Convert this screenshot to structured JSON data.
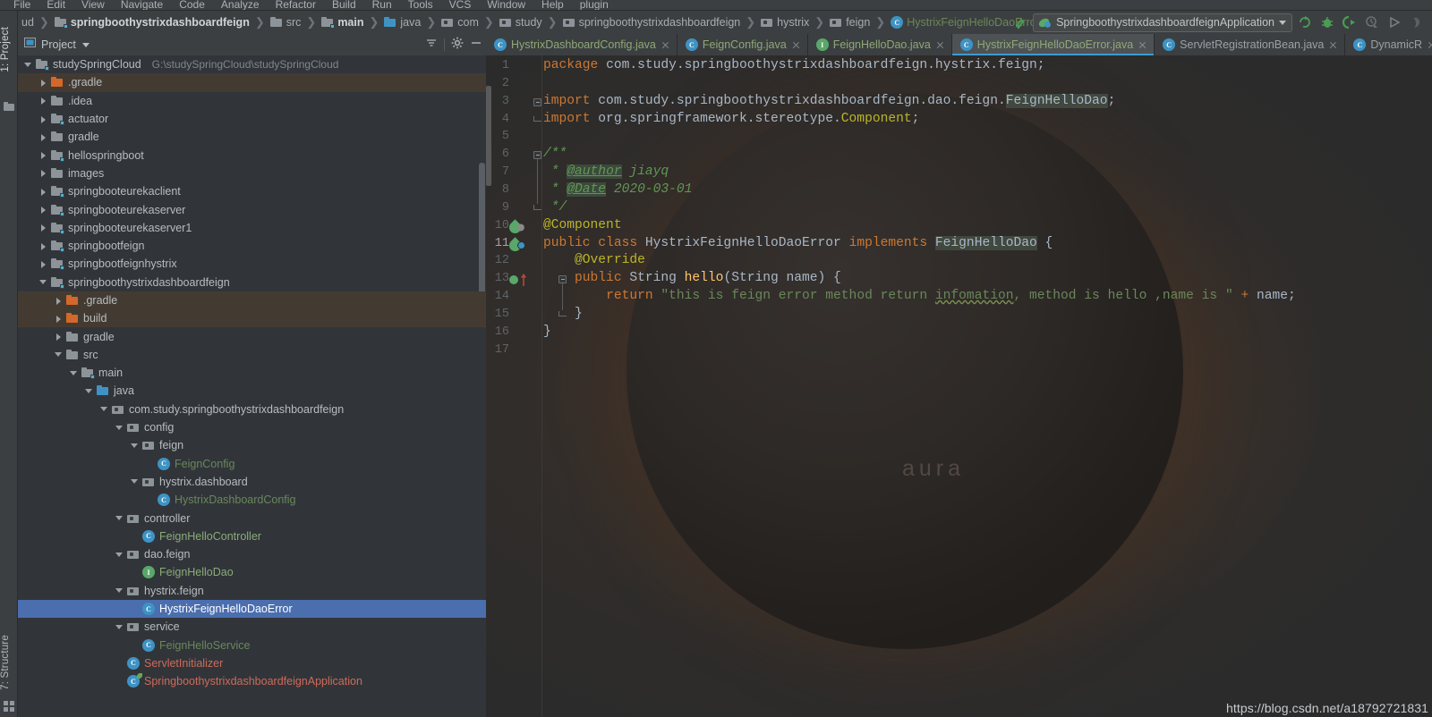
{
  "menu": {
    "items": [
      "File",
      "Edit",
      "View",
      "Navigate",
      "Code",
      "Analyze",
      "Refactor",
      "Build",
      "Run",
      "Tools",
      "VCS",
      "Window",
      "Help",
      "plugin"
    ]
  },
  "breadcrumb": {
    "items": [
      {
        "label": "ud",
        "icon": "folder-icon",
        "bold": false,
        "kind": "plain"
      },
      {
        "label": "springboothystrixdashboardfeign",
        "icon": "module-folder-icon",
        "bold": true,
        "kind": "module"
      },
      {
        "label": "src",
        "icon": "folder-icon",
        "bold": false,
        "kind": "plain"
      },
      {
        "label": "main",
        "icon": "module-folder-icon",
        "bold": true,
        "kind": "module"
      },
      {
        "label": "java",
        "icon": "source-folder-icon",
        "bold": false,
        "kind": "source"
      },
      {
        "label": "com",
        "icon": "package-icon",
        "bold": false,
        "kind": "package"
      },
      {
        "label": "study",
        "icon": "package-icon",
        "bold": false,
        "kind": "package"
      },
      {
        "label": "springboothystrixdashboardfeign",
        "icon": "package-icon",
        "bold": false,
        "kind": "package"
      },
      {
        "label": "hystrix",
        "icon": "package-icon",
        "bold": false,
        "kind": "package"
      },
      {
        "label": "feign",
        "icon": "package-icon",
        "bold": false,
        "kind": "package"
      },
      {
        "label": "HystrixFeignHelloDaoError",
        "icon": "class-icon",
        "bold": false,
        "kind": "class"
      }
    ]
  },
  "toolbar": {
    "run_configuration": "SpringboothystrixdashboardfeignApplication",
    "buttons": [
      {
        "name": "rerun-button",
        "title": "Rerun"
      },
      {
        "name": "debug-button",
        "title": "Debug"
      },
      {
        "name": "run-with-coverage-button",
        "title": "Run with Coverage"
      },
      {
        "name": "profile-button",
        "title": "Profile"
      },
      {
        "name": "run-button",
        "title": "Run"
      },
      {
        "name": "stop-button",
        "title": "Stop"
      }
    ]
  },
  "left_strips": {
    "project_tab": "1: Project",
    "structure_tab": "7: Structure"
  },
  "project_panel": {
    "title": "Project",
    "tree": [
      {
        "label": "studySpringCloud",
        "sub": "G:\\studySpringCloud\\studySpringCloud",
        "indent": 0,
        "arrow": "down",
        "icon": "module-folder-icon",
        "color": "default",
        "state": "normal"
      },
      {
        "label": ".gradle",
        "indent": 1,
        "arrow": "right",
        "icon": "folder-icon-orange",
        "color": "default",
        "state": "excluded"
      },
      {
        "label": ".idea",
        "indent": 1,
        "arrow": "right",
        "icon": "folder-icon",
        "color": "default",
        "state": "normal"
      },
      {
        "label": "actuator",
        "indent": 1,
        "arrow": "right",
        "icon": "module-folder-icon",
        "color": "default",
        "state": "normal"
      },
      {
        "label": "gradle",
        "indent": 1,
        "arrow": "right",
        "icon": "folder-icon",
        "color": "default",
        "state": "normal"
      },
      {
        "label": "hellospringboot",
        "indent": 1,
        "arrow": "right",
        "icon": "module-folder-icon",
        "color": "default",
        "state": "normal"
      },
      {
        "label": "images",
        "indent": 1,
        "arrow": "right",
        "icon": "folder-icon",
        "color": "default",
        "state": "normal"
      },
      {
        "label": "springbooteurekaclient",
        "indent": 1,
        "arrow": "right",
        "icon": "module-folder-icon",
        "color": "default",
        "state": "normal"
      },
      {
        "label": "springbooteurekaserver",
        "indent": 1,
        "arrow": "right",
        "icon": "module-folder-icon",
        "color": "default",
        "state": "normal"
      },
      {
        "label": "springbooteurekaserver1",
        "indent": 1,
        "arrow": "right",
        "icon": "module-folder-icon",
        "color": "default",
        "state": "normal"
      },
      {
        "label": "springbootfeign",
        "indent": 1,
        "arrow": "right",
        "icon": "module-folder-icon",
        "color": "default",
        "state": "normal"
      },
      {
        "label": "springbootfeignhystrix",
        "indent": 1,
        "arrow": "right",
        "icon": "module-folder-icon",
        "color": "default",
        "state": "normal"
      },
      {
        "label": "springboothystrixdashboardfeign",
        "indent": 1,
        "arrow": "down",
        "icon": "module-folder-icon",
        "color": "default",
        "state": "normal"
      },
      {
        "label": ".gradle",
        "indent": 2,
        "arrow": "right",
        "icon": "folder-icon-orange",
        "color": "default",
        "state": "excluded"
      },
      {
        "label": "build",
        "indent": 2,
        "arrow": "right",
        "icon": "folder-icon-orange",
        "color": "default",
        "state": "excluded"
      },
      {
        "label": "gradle",
        "indent": 2,
        "arrow": "right",
        "icon": "folder-icon",
        "color": "default",
        "state": "normal"
      },
      {
        "label": "src",
        "indent": 2,
        "arrow": "down",
        "icon": "folder-icon",
        "color": "default",
        "state": "normal"
      },
      {
        "label": "main",
        "indent": 3,
        "arrow": "down",
        "icon": "module-folder-icon",
        "color": "default",
        "state": "normal"
      },
      {
        "label": "java",
        "indent": 4,
        "arrow": "down",
        "icon": "source-folder-icon",
        "color": "default",
        "state": "normal"
      },
      {
        "label": "com.study.springboothystrixdashboardfeign",
        "indent": 5,
        "arrow": "down",
        "icon": "package-icon",
        "color": "default",
        "state": "normal"
      },
      {
        "label": "config",
        "indent": 6,
        "arrow": "down",
        "icon": "package-icon",
        "color": "default",
        "state": "normal"
      },
      {
        "label": "feign",
        "indent": 7,
        "arrow": "down",
        "icon": "package-icon",
        "color": "default",
        "state": "normal"
      },
      {
        "label": "FeignConfig",
        "indent": 8,
        "arrow": "none",
        "icon": "class-icon",
        "color": "green",
        "state": "normal"
      },
      {
        "label": "hystrix.dashboard",
        "indent": 7,
        "arrow": "down",
        "icon": "package-icon",
        "color": "default",
        "state": "normal"
      },
      {
        "label": "HystrixDashboardConfig",
        "indent": 8,
        "arrow": "none",
        "icon": "class-icon",
        "color": "green",
        "state": "normal"
      },
      {
        "label": "controller",
        "indent": 6,
        "arrow": "down",
        "icon": "package-icon",
        "color": "default",
        "state": "normal"
      },
      {
        "label": "FeignHelloController",
        "indent": 7,
        "arrow": "none",
        "icon": "class-icon",
        "color": "green-light",
        "state": "normal"
      },
      {
        "label": "dao.feign",
        "indent": 6,
        "arrow": "down",
        "icon": "package-icon",
        "color": "default",
        "state": "normal"
      },
      {
        "label": "FeignHelloDao",
        "indent": 7,
        "arrow": "none",
        "icon": "interface-icon",
        "color": "green-light",
        "state": "normal"
      },
      {
        "label": "hystrix.feign",
        "indent": 6,
        "arrow": "down",
        "icon": "package-icon",
        "color": "default",
        "state": "normal"
      },
      {
        "label": "HystrixFeignHelloDaoError",
        "indent": 7,
        "arrow": "none",
        "icon": "class-icon",
        "color": "default",
        "state": "selected"
      },
      {
        "label": "service",
        "indent": 6,
        "arrow": "down",
        "icon": "package-icon",
        "color": "default",
        "state": "normal"
      },
      {
        "label": "FeignHelloService",
        "indent": 7,
        "arrow": "none",
        "icon": "class-icon",
        "color": "green",
        "state": "normal"
      },
      {
        "label": "ServletInitializer",
        "indent": 6,
        "arrow": "none",
        "icon": "class-icon",
        "color": "red",
        "state": "normal"
      },
      {
        "label": "SpringboothystrixdashboardfeignApplication",
        "indent": 6,
        "arrow": "none",
        "icon": "spring-class-icon",
        "color": "red",
        "state": "normal"
      }
    ]
  },
  "editor": {
    "tabs": [
      {
        "label": "HystrixDashboardConfig.java",
        "icon": "class-icon",
        "active": false,
        "color": "green"
      },
      {
        "label": "FeignConfig.java",
        "icon": "class-icon",
        "active": false,
        "color": "green"
      },
      {
        "label": "FeignHelloDao.java",
        "icon": "interface-icon",
        "active": false,
        "color": "green"
      },
      {
        "label": "HystrixFeignHelloDaoError.java",
        "icon": "class-icon",
        "active": true,
        "color": "green"
      },
      {
        "label": "ServletRegistrationBean.java",
        "icon": "class-icon",
        "active": false,
        "color": "gray"
      },
      {
        "label": "DynamicR",
        "icon": "class-icon",
        "active": false,
        "color": "gray"
      }
    ],
    "line_numbers": [
      "1",
      "2",
      "3",
      "4",
      "5",
      "6",
      "7",
      "8",
      "9",
      "10",
      "11",
      "12",
      "13",
      "14",
      "15",
      "16",
      "17"
    ],
    "current_line": "11",
    "code_lines": [
      "package com.study.springboothystrixdashboardfeign.hystrix.feign;",
      "",
      "import com.study.springboothystrixdashboardfeign.dao.feign.FeignHelloDao;",
      "import org.springframework.stereotype.Component;",
      "",
      "/**",
      " * @author jiayq",
      " * @Date 2020-03-01",
      " */",
      "@Component",
      "public class HystrixFeignHelloDaoError implements FeignHelloDao {",
      "    @Override",
      "    public String hello(String name) {",
      "        return \"this is feign error method return infomation, method is hello ,name is \" + name;",
      "    }",
      "}",
      ""
    ]
  },
  "background": {
    "aura_word": "aura"
  },
  "watermark": "https://blog.csdn.net/a18792721831",
  "colors": {
    "accent_blue": "#3d9bd4",
    "selection_blue": "#4b6eaf",
    "keyword_orange": "#cc7832",
    "string_green": "#6a8759",
    "comment_green": "#629755",
    "annotation_yellow": "#bbb529",
    "method_yellow": "#ffc66d",
    "identifier": "#a9b7c6",
    "editor_bg": "#2b2b2b",
    "panel_bg": "#3c3f41",
    "tree_bg": "#31353a",
    "excluded_bg": "#433b32",
    "error_red": "#cf6a59"
  }
}
